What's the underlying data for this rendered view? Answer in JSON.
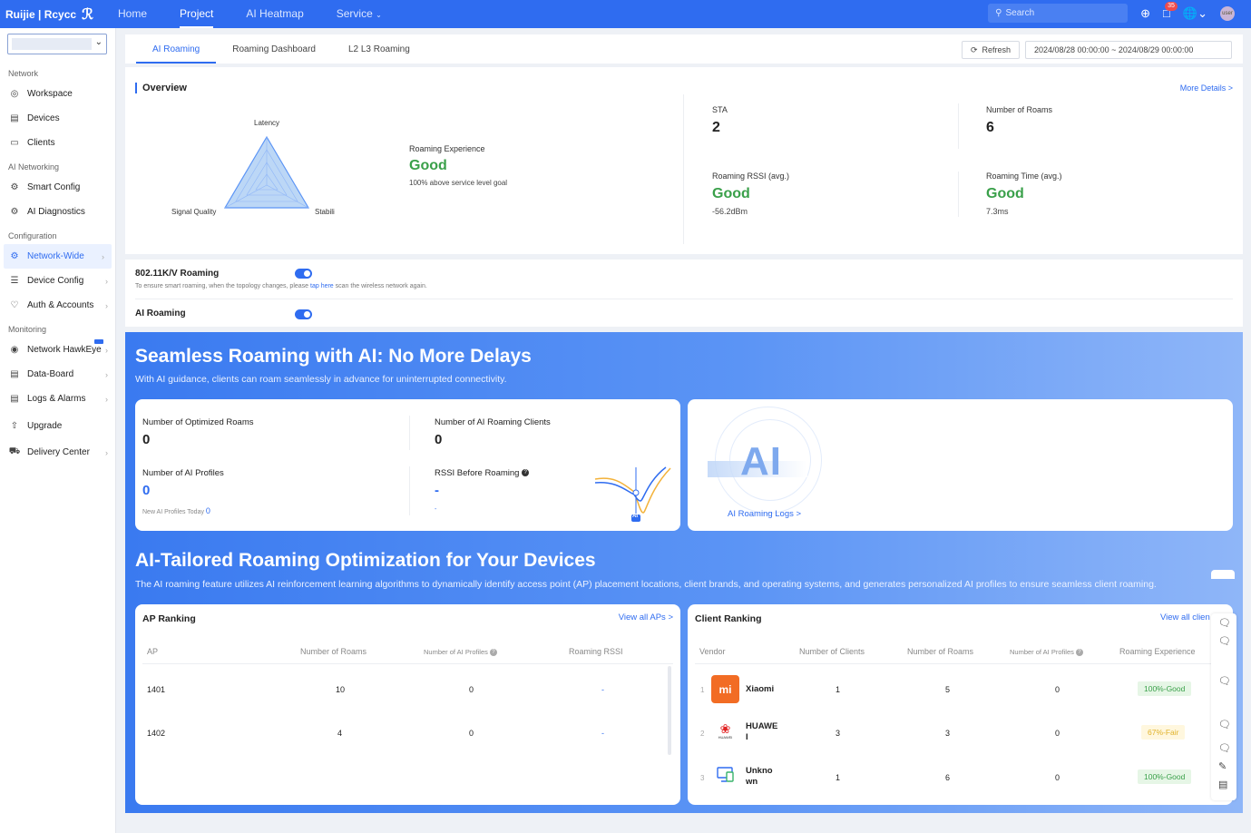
{
  "topbar": {
    "brand": "Ruijie | Rcycc",
    "nav": [
      "Home",
      "Project",
      "AI Heatmap",
      "Service"
    ],
    "search_placeholder": "Search",
    "notification_count": "35",
    "avatar_text": "user"
  },
  "sidebar": {
    "sections": [
      {
        "title": "Network",
        "items": [
          "Workspace",
          "Devices",
          "Clients"
        ]
      },
      {
        "title": "AI Networking",
        "items": [
          "Smart Config",
          "AI Diagnostics"
        ]
      },
      {
        "title": "Configuration",
        "items": [
          "Network-Wide",
          "Device Config",
          "Auth & Accounts"
        ]
      },
      {
        "title": "Monitoring",
        "items": [
          "Network HawkEye",
          "Data-Board",
          "Logs & Alarms",
          "Upgrade",
          "Delivery Center"
        ]
      }
    ]
  },
  "tabs": [
    "AI Roaming",
    "Roaming Dashboard",
    "L2 L3 Roaming"
  ],
  "toolbar": {
    "refresh_label": "Refresh",
    "date_range": "2024/08/28 00:00:00 ~ 2024/08/29 00:00:00"
  },
  "overview": {
    "title": "Overview",
    "more_details": "More Details >",
    "radar_labels": {
      "top": "Latency",
      "left": "Signal Quality",
      "right": "Stabili"
    },
    "experience_label": "Roaming Experience",
    "experience_value": "Good",
    "experience_desc": "100% above service level goal",
    "metrics": {
      "sta_label": "STA",
      "sta_value": "2",
      "roams_label": "Number of Roams",
      "roams_value": "6",
      "rssi_label": "Roaming RSSI (avg.)",
      "rssi_value": "Good",
      "rssi_sub": "-56.2dBm",
      "time_label": "Roaming Time (avg.)",
      "time_value": "Good",
      "time_sub": "7.3ms"
    }
  },
  "settings": {
    "kv_title": "802.11K/V Roaming",
    "kv_desc_pre": "To ensure smart roaming, when the topology changes, please",
    "kv_desc_link": "tap here",
    "kv_desc_post": "scan the wireless network again.",
    "ai_title": "AI Roaming",
    "kv_enabled": true,
    "ai_enabled": true
  },
  "ai_banner": {
    "title": "Seamless Roaming with AI: No More Delays",
    "subtitle": "With AI guidance, clients can roam seamlessly in advance for uninterrupted connectivity.",
    "optimized_label": "Number of Optimized Roams",
    "optimized_value": "0",
    "ai_clients_label": "Number of AI Roaming Clients",
    "ai_clients_value": "0",
    "profiles_label": "Number of AI Profiles",
    "profiles_value": "0",
    "new_profiles_label": "New AI Profiles Today",
    "new_profiles_value": "0",
    "rssi_before_label": "RSSI Before Roaming",
    "rssi_before_value": "-",
    "rssi_before_sub": "-",
    "ai_logo_text": "AI",
    "chart_marker_text": "AI",
    "logs_link": "AI Roaming Logs >"
  },
  "optimization": {
    "title": "AI-Tailored Roaming Optimization for Your Devices",
    "subtitle": "The AI roaming feature utilizes AI reinforcement learning algorithms to dynamically identify access point (AP) placement locations, client brands, and operating systems, and generates personalized AI profiles to ensure seamless client roaming."
  },
  "ap_ranking": {
    "title": "AP Ranking",
    "view_all": "View all APs >",
    "columns": [
      "AP",
      "Number of Roams",
      "Number of AI Profiles",
      "Roaming RSSI"
    ],
    "rows": [
      {
        "ap": "1401",
        "roams": "10",
        "profiles": "0",
        "rssi": "-"
      },
      {
        "ap": "1402",
        "roams": "4",
        "profiles": "0",
        "rssi": "-"
      }
    ]
  },
  "client_ranking": {
    "title": "Client Ranking",
    "view_all": "View all clien",
    "columns": [
      "Vendor",
      "Number of Clients",
      "Number of Roams",
      "Number of AI Profiles",
      "Roaming Experience"
    ],
    "rows": [
      {
        "rank": "1",
        "vendor": "Xiaomi",
        "logo_text": "mi",
        "clients": "1",
        "roams": "5",
        "profiles": "0",
        "experience": "100%-Good"
      },
      {
        "rank": "2",
        "vendor": "HUAWE I",
        "logo_text": "HUAWEI",
        "clients": "3",
        "roams": "3",
        "profiles": "0",
        "experience": "67%-Fair"
      },
      {
        "rank": "3",
        "vendor": "Unkno wn",
        "logo_text": "",
        "clients": "1",
        "roams": "6",
        "profiles": "0",
        "experience": "100%-Good"
      }
    ]
  },
  "colors": {
    "primary": "#2f6cf0",
    "good": "#3aa04a",
    "fair": "#e0b22a"
  }
}
